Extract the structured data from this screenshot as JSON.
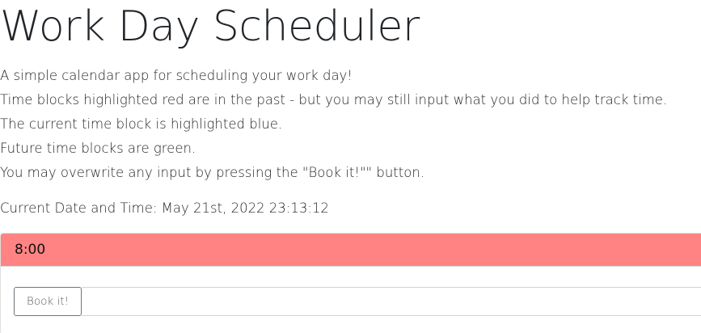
{
  "header": {
    "title": "Work Day Scheduler",
    "description_lines": [
      "A simple calendar app for scheduling your work day!",
      "Time blocks highlighted red are in the past - but you may still input what you did to help track time.",
      "The current time block is highlighted blue.",
      "Future time blocks are green.",
      "You may overwrite any input by pressing the \"Book it!\"\" button."
    ],
    "current_datetime": "Current Date and Time: May 21st, 2022 23:13:12"
  },
  "time_blocks": [
    {
      "hour_label": "8:00",
      "status": "past",
      "status_color": "#ff8383",
      "button_label": "Book it!",
      "entry_value": ""
    }
  ]
}
